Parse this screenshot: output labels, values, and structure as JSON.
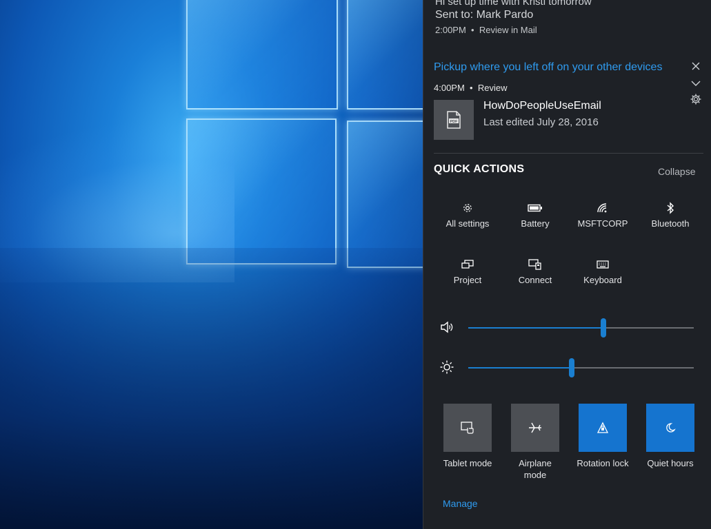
{
  "notification_email": {
    "title": "Hi set up time with Kristi tomorrow",
    "sent_to": "Sent to: Mark Pardo",
    "time": "2:00PM",
    "action": "Review in Mail"
  },
  "notification_pickup": {
    "title": "Pickup where you left off on your other devices",
    "time": "4:00PM",
    "action": "Review",
    "document_name": "HowDoPeopleUseEmail",
    "last_edited": "Last edited July 28, 2016",
    "file_badge": "PDF"
  },
  "quick_actions": {
    "title": "QUICK ACTIONS",
    "collapse_label": "Collapse",
    "buttons": [
      {
        "label": "All settings",
        "icon": "gear-icon"
      },
      {
        "label": "Battery",
        "icon": "battery-icon"
      },
      {
        "label": "MSFTCORP",
        "icon": "wifi-icon"
      },
      {
        "label": "Bluetooth",
        "icon": "bluetooth-icon"
      },
      {
        "label": "Project",
        "icon": "project-icon"
      },
      {
        "label": "Connect",
        "icon": "connect-icon"
      },
      {
        "label": "Keyboard",
        "icon": "keyboard-icon"
      }
    ],
    "volume_level": 0.6,
    "brightness_level": 0.46,
    "toggles": [
      {
        "label": "Tablet mode",
        "state": "off",
        "icon": "tablet-mode-icon"
      },
      {
        "label": "Airplane mode",
        "state": "off",
        "icon": "airplane-icon"
      },
      {
        "label": "Rotation lock",
        "state": "on",
        "icon": "rotation-lock-icon"
      },
      {
        "label": "Quiet hours",
        "state": "on",
        "icon": "moon-icon"
      }
    ],
    "manage_label": "Manage"
  },
  "colors": {
    "accent": "#1574cf",
    "link": "#2f9bef",
    "panel_bg": "#1e2126",
    "tile_off": "#4c4f54"
  }
}
